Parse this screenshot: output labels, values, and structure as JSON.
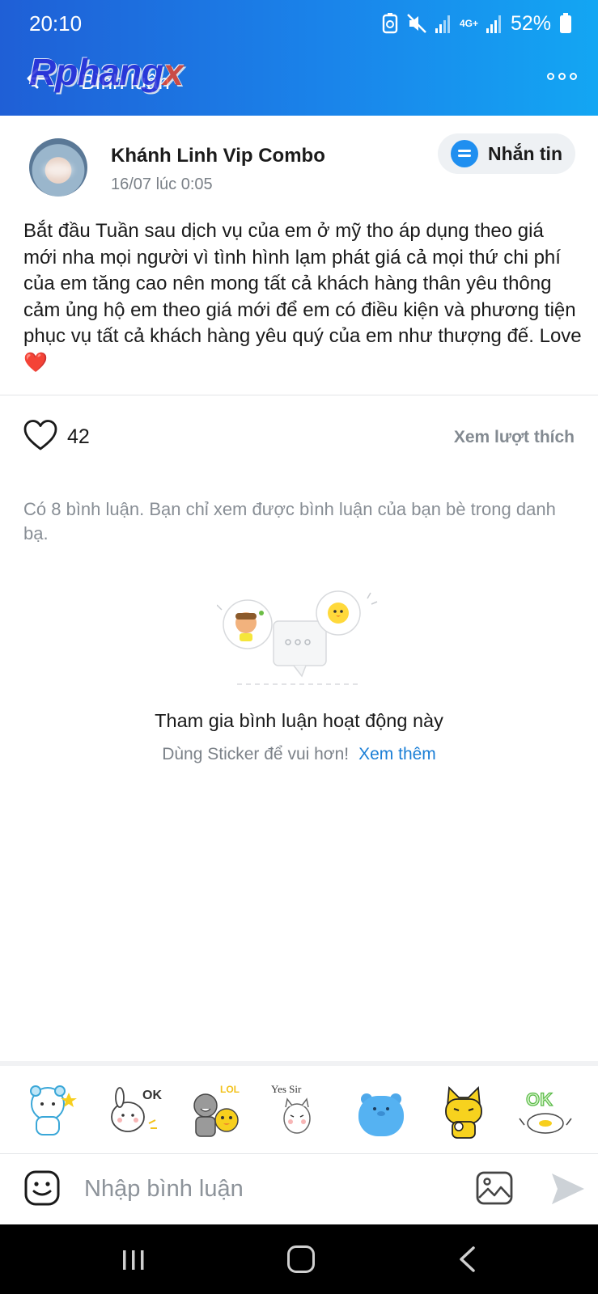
{
  "status_bar": {
    "time": "20:10",
    "network": "4G+",
    "battery": "52%"
  },
  "header": {
    "title": "Bình luận",
    "watermark_main": "Rphang",
    "watermark_x": "x",
    "colors": {
      "gradient_start": "#1f5fd6",
      "gradient_end": "#13a6f3"
    }
  },
  "post": {
    "author": "Khánh Linh Vip Combo",
    "timestamp": "16/07 lúc 0:05",
    "message_button": "Nhắn tin",
    "body": "Bắt đầu Tuần sau dịch vụ của em ở mỹ tho áp dụng theo giá mới nha mọi người vì tình hình lạm phát giá cả mọi thứ chi phí của em tăng cao nên mong tất cả khách hàng thân yêu thông cảm ủng hộ em theo giá mới để em có điều kiện và phương tiện phục vụ tất cả khách hàng yêu quý của em như thượng đế. Love",
    "body_emoji": "❤️"
  },
  "likes": {
    "count": "42",
    "see_likes": "Xem lượt thích"
  },
  "comments_note": "Có 8 bình luận. Bạn chỉ xem được bình luận của bạn bè trong danh bạ.",
  "empty_state": {
    "title": "Tham gia bình luận hoạt động này",
    "subtitle": "Dùng Sticker để vui hơn!",
    "link": "Xem thêm"
  },
  "stickers": [
    {
      "name": "bear-sticker-icon"
    },
    {
      "name": "ok-bunny-sticker-icon",
      "text": "OK"
    },
    {
      "name": "lol-duo-sticker-icon",
      "text": "LOL"
    },
    {
      "name": "yes-sir-cat-sticker-icon",
      "text": "Yes Sir"
    },
    {
      "name": "blue-bear-sticker-icon"
    },
    {
      "name": "yellow-cat-sticker-icon"
    },
    {
      "name": "ok-duck-sticker-icon",
      "text": "OK"
    }
  ],
  "composer": {
    "placeholder": "Nhập bình luận"
  }
}
